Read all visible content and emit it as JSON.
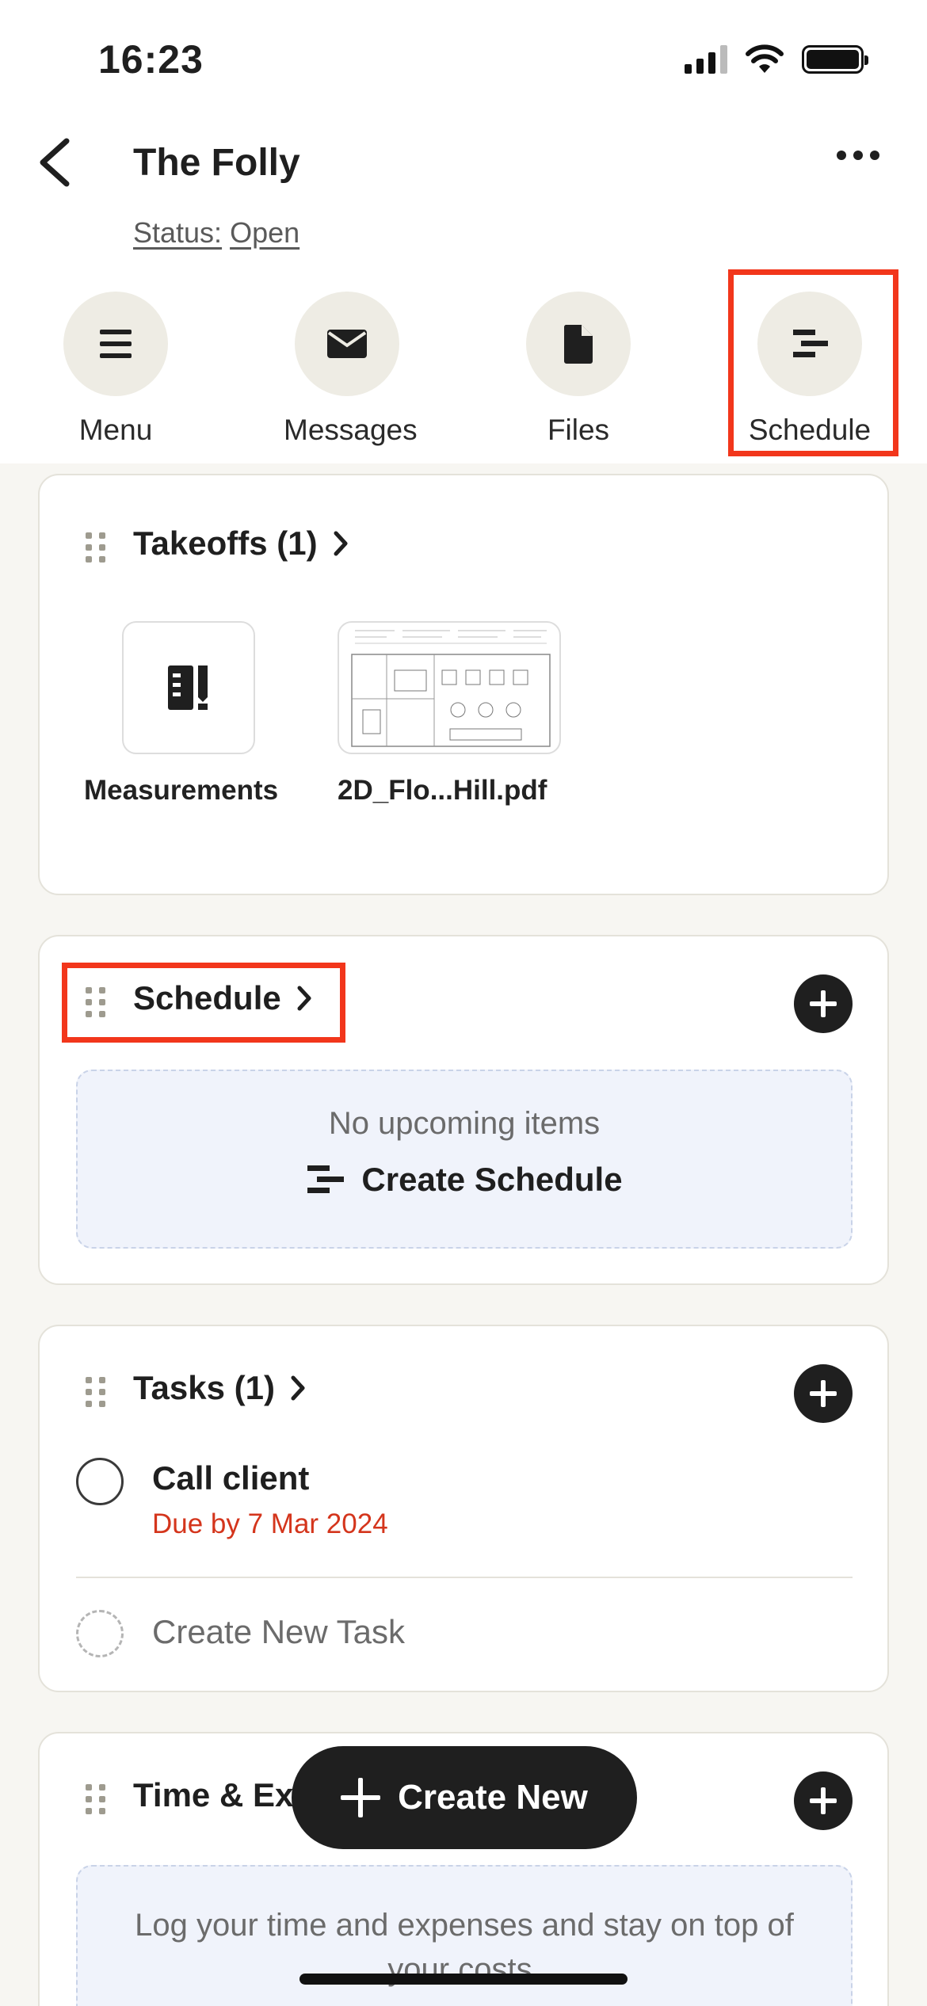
{
  "status_bar": {
    "time": "16:23"
  },
  "header": {
    "title": "The Folly",
    "status_label": "Status:",
    "status_value": "Open"
  },
  "quick_actions": [
    {
      "label": "Menu",
      "icon": "menu-icon"
    },
    {
      "label": "Messages",
      "icon": "envelope-icon"
    },
    {
      "label": "Files",
      "icon": "file-icon"
    },
    {
      "label": "Schedule",
      "icon": "schedule-icon",
      "highlighted": true
    }
  ],
  "takeoffs": {
    "title": "Takeoffs (1)",
    "items": [
      {
        "label": "Measurements",
        "icon": "measurements-icon"
      },
      {
        "label": "2D_Flo...Hill.pdf",
        "icon": "floorplan-thumbnail"
      }
    ]
  },
  "schedule": {
    "title": "Schedule",
    "highlighted": true,
    "empty_text": "No upcoming items",
    "create_label": "Create Schedule"
  },
  "tasks": {
    "title": "Tasks (1)",
    "items": [
      {
        "name": "Call client",
        "due": "Due by 7 Mar 2024"
      }
    ],
    "create_label": "Create New Task"
  },
  "time_expenses": {
    "title_visible": "Time & Ex",
    "empty_text": "Log your time and expenses and stay on top of your costs."
  },
  "fab": {
    "label": "Create New"
  },
  "colors": {
    "accent_red": "#f2361b",
    "due_red": "#d4351c",
    "dark": "#1f1f1f",
    "chip_bg": "#eeece4",
    "panel_bg": "#f0f3fb"
  }
}
